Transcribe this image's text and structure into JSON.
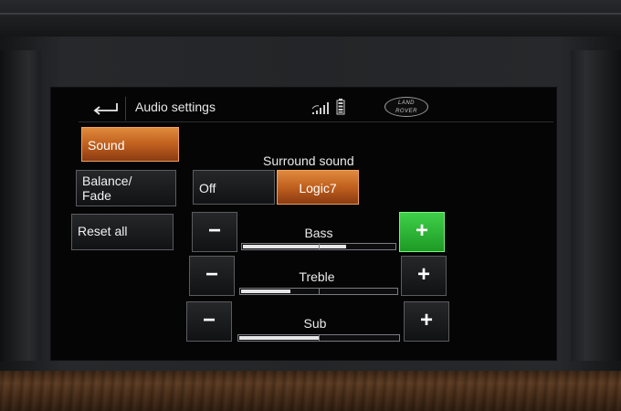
{
  "header": {
    "title": "Audio settings",
    "back_icon": "back-arrow-icon",
    "signal_icon": "signal-strength-icon",
    "battery_icon": "battery-icon",
    "logo_line1": "LAND",
    "logo_line2": "ROVER"
  },
  "menu": {
    "items": [
      {
        "label": "Sound",
        "selected": true
      },
      {
        "label": "Balance/ Fade",
        "selected": false
      },
      {
        "label": "Reset all",
        "selected": false
      }
    ]
  },
  "surround": {
    "label": "Surround sound",
    "options": [
      {
        "label": "Off",
        "selected": false
      },
      {
        "label": "Logic7",
        "selected": true
      }
    ]
  },
  "controls": {
    "minus_label": "−",
    "plus_label": "+",
    "rows": [
      {
        "label": "Bass",
        "level": 0.68,
        "plus_active": true
      },
      {
        "label": "Treble",
        "level": 0.32,
        "plus_active": false
      },
      {
        "label": "Sub",
        "level": 0.5,
        "plus_active": false
      }
    ]
  },
  "colors": {
    "selected_orange": "#c0601e",
    "active_green": "#2bb834"
  }
}
